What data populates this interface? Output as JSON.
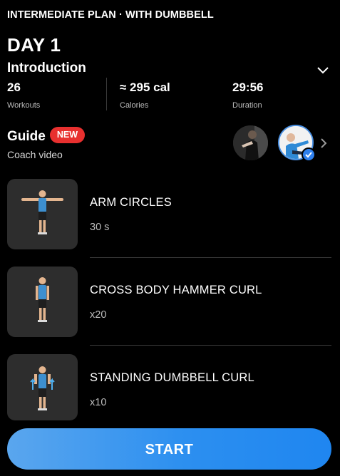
{
  "plan_title": "INTERMEDIATE PLAN · WITH DUMBBELL",
  "day_title": "DAY 1",
  "section_title": "Introduction",
  "stats": [
    {
      "value": "26",
      "label": "Workouts"
    },
    {
      "value": "≈ 295 cal",
      "label": "Calories"
    },
    {
      "value": "29:56",
      "label": "Duration"
    }
  ],
  "guide": {
    "title": "Guide",
    "badge": "NEW",
    "subtitle": "Coach video"
  },
  "exercises": [
    {
      "name": "ARM CIRCLES",
      "value": "30 s"
    },
    {
      "name": "CROSS BODY HAMMER CURL",
      "value": "x20"
    },
    {
      "name": "STANDING DUMBBELL CURL",
      "value": "x10"
    }
  ],
  "start_label": "START",
  "colors": {
    "accent": "#2f80ed",
    "badge": "#e8302f",
    "card": "#2d2d2d",
    "shirt": "#3d8fcf"
  },
  "icons": {
    "collapse": "chevron-down-icon",
    "guide_next": "chevron-right-icon",
    "selected": "checkmark-icon"
  }
}
